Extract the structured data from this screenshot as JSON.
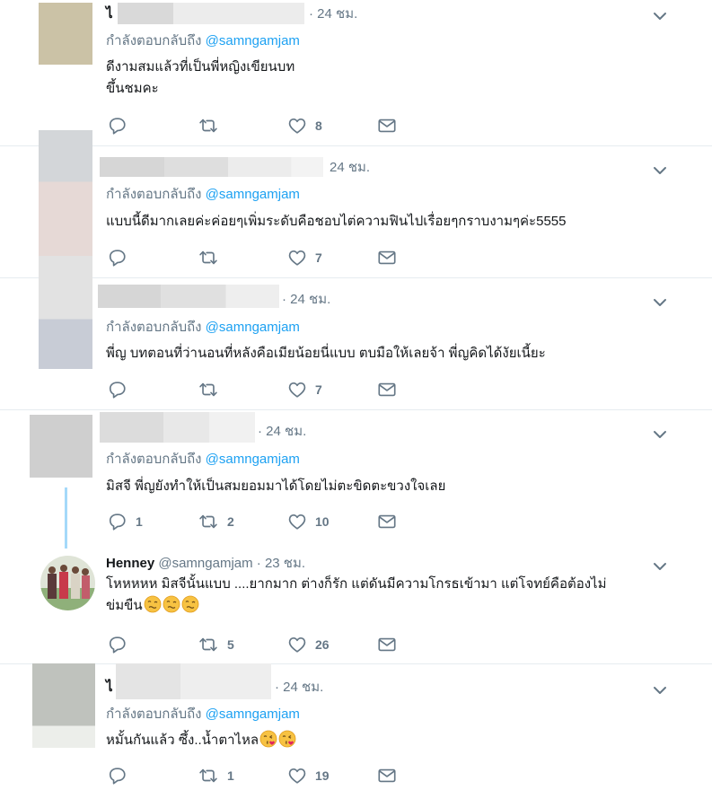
{
  "reply_label": "กำลังตอบกลับถึง",
  "mention": "@samngamjam",
  "tweets": [
    {
      "name": "ไ",
      "handle": "",
      "time": "· 24 ชม.",
      "text_lines": [
        "ดีงามสมแล้วที่เป็นพี่หญิงเขียนบท",
        "ขึ้นชมคะ"
      ],
      "reply_count": "",
      "retweet_count": "",
      "like_count": "8"
    },
    {
      "name": "",
      "handle": "",
      "time": "24 ชม.",
      "text_lines": [
        "แบบนี้ดีมากเลยค่ะค่อยๆเพิ่มระดับคือชอบไต่ความฟินไปเรื่อยๆกราบงามๆค่ะ5555"
      ],
      "reply_count": "",
      "retweet_count": "",
      "like_count": "7"
    },
    {
      "name": "",
      "handle": "",
      "time": "· 24 ชม.",
      "text_lines": [
        "พี่ญ บทตอนที่ว่านอนที่หลังคือเมียน้อยนี่แบบ ตบมือให้เลยจ้า พี่ญคิดได้งัยเนี้ยะ"
      ],
      "reply_count": "",
      "retweet_count": "",
      "like_count": "7"
    },
    {
      "name": "",
      "handle": "",
      "time": "· 24 ชม.",
      "text_lines": [
        "มิสจี พี่ญยังทำให้เป็นสมยอมมาได้โดยไม่ตะขิดตะขวงใจเลย"
      ],
      "reply_count": "1",
      "retweet_count": "2",
      "like_count": "10"
    },
    {
      "name": "Henney",
      "handle": "@samngamjam",
      "time": "· 23 ชม.",
      "text_lines": [
        "โหหหหห มิสจีนั้นแบบ ....ยากมาก ต่างก็รัก แต่ดันมีความโกรธเข้ามา แต่โจทย์คือต้องไม่",
        "ข่มขืน"
      ],
      "reply_count": "",
      "retweet_count": "5",
      "like_count": "26"
    },
    {
      "name": "ไ",
      "handle": "",
      "time": "· 24 ชม.",
      "text_lines": [
        "หมั้นกันแล้ว ซึ้ง..น้ำตาไหล"
      ],
      "reply_count": "",
      "retweet_count": "1",
      "like_count": "19"
    }
  ],
  "icons": {
    "reply": "reply-icon",
    "retweet": "retweet-icon",
    "like": "heart-icon",
    "dm": "envelope-icon",
    "menu": "chevron-down-icon",
    "emoji_t5": "woozy-face-emoji",
    "emoji_t6": "face-blowing-kiss-emoji"
  },
  "colors": {
    "link": "#1da1f2",
    "secondary": "#657786",
    "thread_line": "#a4d9f9",
    "divider": "#e6ecf0"
  }
}
